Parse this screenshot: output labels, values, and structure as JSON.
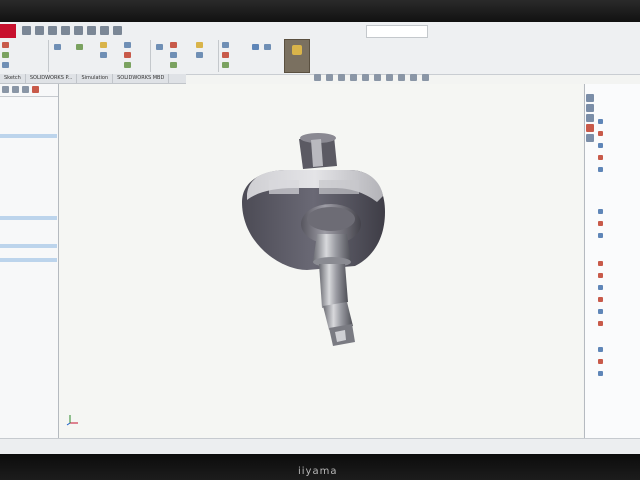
{
  "monitor": {
    "brand": "iiyama"
  },
  "app": {
    "name": "SOLIDWORKS",
    "accent": "#c8102e"
  },
  "ribbon": {
    "search_placeholder": "",
    "commands": []
  },
  "tabs": [
    {
      "label": "Sketch"
    },
    {
      "label": "SOLIDWORKS P..."
    },
    {
      "label": "Simulation"
    },
    {
      "label": "SOLIDWORKS MBD"
    }
  ],
  "left_panel": {
    "items": []
  },
  "task_pane": {
    "headers": [],
    "items": []
  },
  "taskbar": {
    "apps": [
      "task-view",
      "file-explorer",
      "edge",
      "solidworks"
    ]
  },
  "colors": {
    "screen_bg": "#f3f4f2",
    "part_body": "#5e5c66",
    "part_shaft": "#6a6b72",
    "taskbar": "#202225"
  }
}
